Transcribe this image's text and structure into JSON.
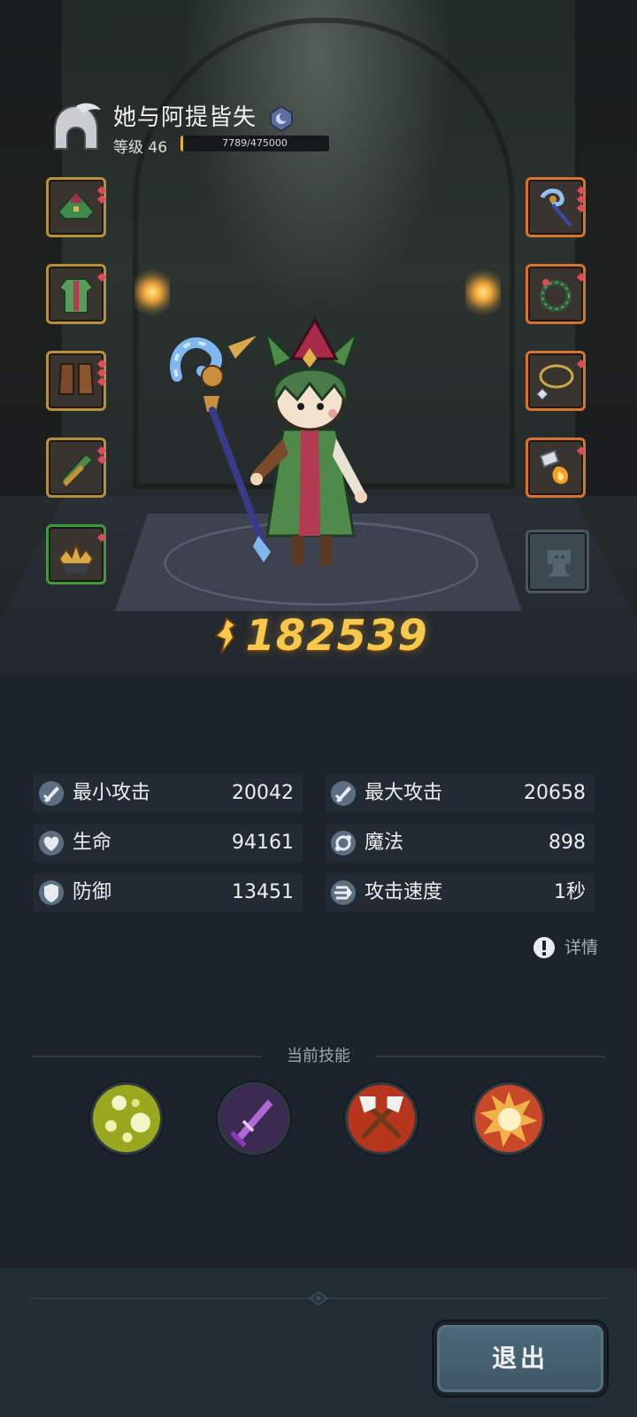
{
  "player": {
    "name": "她与阿提皆失",
    "level_label": "等级 46",
    "exp_text": "7789/475000",
    "exp_fraction": 0.0164
  },
  "equipment": {
    "left": [
      {
        "name": "helmet-hat",
        "rarity": "gold"
      },
      {
        "name": "armor-robe",
        "rarity": "gold"
      },
      {
        "name": "boots",
        "rarity": "gold"
      },
      {
        "name": "gloves",
        "rarity": "gold"
      },
      {
        "name": "crown",
        "rarity": "green"
      }
    ],
    "right": [
      {
        "name": "staff-weapon",
        "rarity": "orange"
      },
      {
        "name": "ring",
        "rarity": "orange"
      },
      {
        "name": "necklace",
        "rarity": "orange"
      },
      {
        "name": "fire-charm",
        "rarity": "orange"
      },
      {
        "name": "empty-slot",
        "rarity": "empty"
      }
    ]
  },
  "power": {
    "value": "182539"
  },
  "stats": [
    {
      "label": "最小攻击",
      "value": "20042",
      "icon": "sword-icon"
    },
    {
      "label": "最大攻击",
      "value": "20658",
      "icon": "sword-icon"
    },
    {
      "label": "生命",
      "value": "94161",
      "icon": "heart-icon"
    },
    {
      "label": "魔法",
      "value": "898",
      "icon": "magic-icon"
    },
    {
      "label": "防御",
      "value": "13451",
      "icon": "shield-icon"
    },
    {
      "label": "攻击速度",
      "value": "1秒",
      "icon": "speed-icon"
    }
  ],
  "details_label": "详情",
  "skills": {
    "title": "当前技能",
    "items": [
      {
        "name": "poison-bubbles-skill",
        "color": "#9aa81f"
      },
      {
        "name": "purple-blade-skill",
        "color": "#6b3a8e"
      },
      {
        "name": "crossed-axes-skill",
        "color": "#b5361d"
      },
      {
        "name": "explosion-skill",
        "color": "#d9a33a"
      }
    ]
  },
  "exit_label": "退出",
  "colors": {
    "accent_gold": "#f7c84b",
    "background": "#1b242c",
    "stat_row": "#222b33",
    "button": "#4d6a7a"
  }
}
